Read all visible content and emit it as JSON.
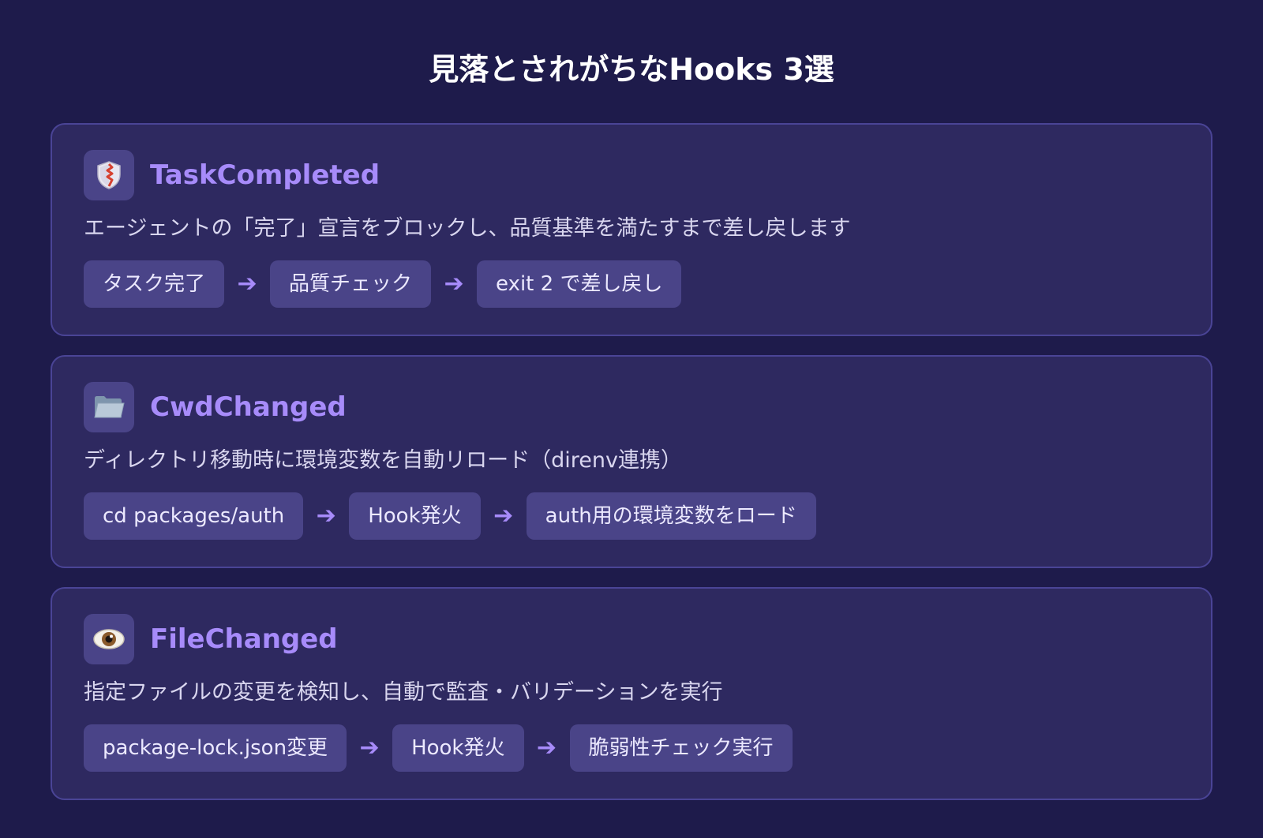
{
  "page": {
    "title": "見落とされがちなHooks 3選"
  },
  "colors": {
    "background": "#1e1b4b",
    "card": "#2e2960",
    "card_border": "#4a4496",
    "chip": "#4a4488",
    "accent": "#a78bfa",
    "title": "#ffffff"
  },
  "arrow_glyph": "➔",
  "cards": [
    {
      "icon": "shield-icon",
      "title": "TaskCompleted",
      "description": "エージェントの「完了」宣言をブロックし、品質基準を満たすまで差し戻します",
      "steps": [
        "タスク完了",
        "品質チェック",
        "exit 2 で差し戻し"
      ]
    },
    {
      "icon": "folder-icon",
      "title": "CwdChanged",
      "description": "ディレクトリ移動時に環境変数を自動リロード（direnv連携）",
      "steps": [
        "cd packages/auth",
        "Hook発火",
        "auth用の環境変数をロード"
      ]
    },
    {
      "icon": "eye-icon",
      "title": "FileChanged",
      "description": "指定ファイルの変更を検知し、自動で監査・バリデーションを実行",
      "steps": [
        "package-lock.json変更",
        "Hook発火",
        "脆弱性チェック実行"
      ]
    }
  ]
}
